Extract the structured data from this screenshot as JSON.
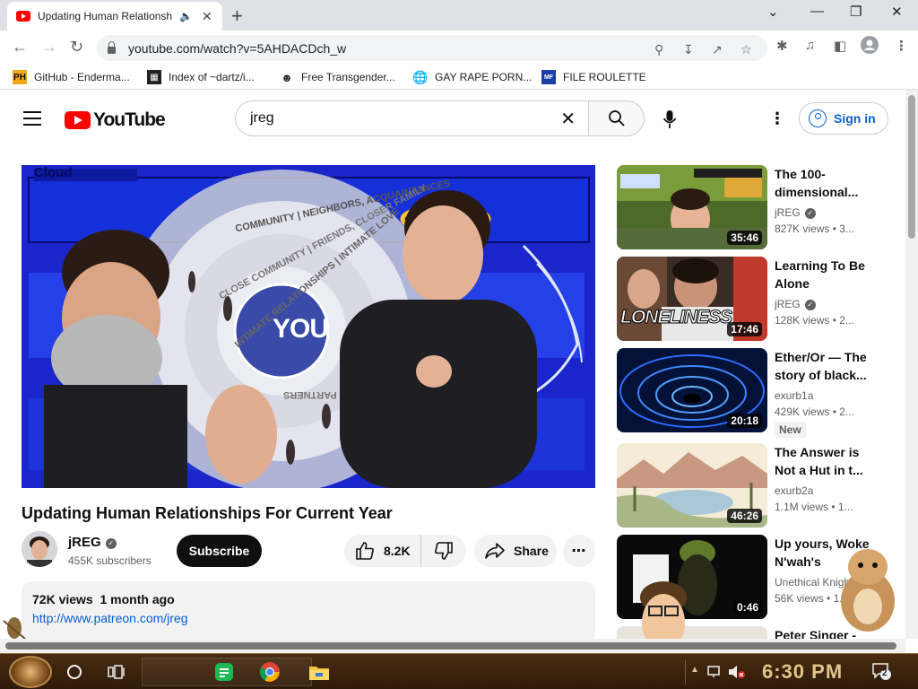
{
  "browser": {
    "tab_title": "Updating Human Relationships For Current Year",
    "url": "youtube.com/watch?v=5AHDACDch_w",
    "bookmarks": [
      {
        "label": "GitHub - Enderma..."
      },
      {
        "label": "Index of ~dartz/i..."
      },
      {
        "label": "Free Transgender..."
      },
      {
        "label": "GAY RAPE PORN..."
      },
      {
        "label": "FILE ROULETTE"
      }
    ]
  },
  "youtube": {
    "logo_text": "YouTube",
    "search_query": "jreg",
    "signin_label": "Sign in"
  },
  "video": {
    "title": "Updating Human Relationships For Current Year",
    "channel": "jREG",
    "subscribers": "455K subscribers",
    "subscribe_label": "Subscribe",
    "likes": "8.2K",
    "share_label": "Share",
    "views": "72K views",
    "posted": "1 month ago",
    "link": "http://www.patreon.com/jreg",
    "thumbnail_text": {
      "center": "YOU",
      "ring_1": "COMMUNITY | NEIGHBORS, ACQUAINTANCES",
      "ring_2": "CLOSE COMMUNITY | FRIENDS, CLOSER FAMILY",
      "ring_3": "INTIMATE RELATIONSHIPS | INTIMATE LOVE",
      "ring_4": "PARTNERS",
      "corner": "Cloud"
    }
  },
  "recommendations": [
    {
      "title": "The 100-dimensional...",
      "channel": "jREG",
      "verified": true,
      "views": "827K views",
      "age": "3...",
      "duration": "35:46",
      "badge": ""
    },
    {
      "title": "Learning To Be Alone",
      "channel": "jREG",
      "verified": true,
      "views": "128K views",
      "age": "2...",
      "duration": "17:46",
      "badge": "",
      "overlay": "LONELINESS"
    },
    {
      "title": "Ether/Or — The story of black...",
      "channel": "exurb1a",
      "verified": false,
      "views": "429K views",
      "age": "2...",
      "duration": "20:18",
      "badge": "New"
    },
    {
      "title": "The Answer is Not a Hut in t...",
      "channel": "exurb2a",
      "verified": false,
      "views": "1.1M views",
      "age": "1...",
      "duration": "46:26",
      "badge": ""
    },
    {
      "title": "Up yours, Woke N'wah's",
      "channel": "Unethical Knigh...",
      "verified": false,
      "views": "56K views",
      "age": "1...",
      "duration": "0:46",
      "badge": ""
    },
    {
      "title": "Peter Singer -",
      "channel": "",
      "verified": false,
      "views": "",
      "age": "",
      "duration": "",
      "badge": ""
    }
  ],
  "taskbar": {
    "clock": "6:30 PM",
    "notification_count": "2"
  },
  "colors": {
    "youtube_red": "#ff0000",
    "link_blue": "#065fd4",
    "player_blue": "#1b2bd0"
  }
}
